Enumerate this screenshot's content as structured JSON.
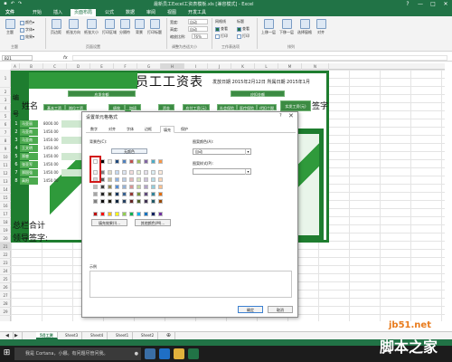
{
  "window": {
    "title": "最新员工Excel工资表模板.xls [兼容模式] - Excel",
    "controls": [
      "?",
      "—",
      "□",
      "✕"
    ]
  },
  "ribbon": {
    "tabs": [
      "文件",
      "开始",
      "插入",
      "页面布局",
      "公式",
      "数据",
      "审阅",
      "视图",
      "开发工具"
    ],
    "active_tab": "页面布局",
    "buttons": {
      "themes": "主题",
      "colors": "颜色▾",
      "fonts": "字体▾",
      "effects": "效果▾",
      "margins": "页边距",
      "orientation": "纸张方向",
      "size": "纸张大小",
      "print_area": "打印区域",
      "breaks": "分隔符",
      "background": "背景",
      "print_titles": "打印标题",
      "bring_forward": "上移一层",
      "send_backward": "下移一层",
      "selection_pane": "选择窗格",
      "align": "对齐"
    },
    "scale": {
      "width_label": "宽度:",
      "width_value": "自动",
      "height_label": "高度:",
      "height_value": "自动",
      "scale_label": "缩放比例:",
      "scale_value": "76%"
    },
    "sheet_options": {
      "gridlines": "网格线",
      "headings": "标题",
      "view": "查看",
      "print": "打印"
    },
    "groups": [
      "主题",
      "页面设置",
      "调整为合适大小",
      "工作表选项",
      "排列"
    ]
  },
  "formula_bar": {
    "name_box": "B21",
    "fx": "fx",
    "value": ""
  },
  "columns": [
    "A",
    "B",
    "C",
    "D",
    "E",
    "F",
    "G",
    "H",
    "I",
    "J",
    "K",
    "L",
    "M",
    "N"
  ],
  "rows": [
    "1",
    "2",
    "3",
    "4",
    "5",
    "6",
    "7",
    "8",
    "9",
    "10",
    "11",
    "12",
    "13",
    "14",
    "15",
    "16",
    "17",
    "18",
    "19",
    "20",
    "21",
    "22",
    "23",
    "24",
    "25",
    "26",
    "27",
    "28",
    "29"
  ],
  "payroll": {
    "title": "员工工资表",
    "date_line": "发放日期  2015年2月12日 所属日期  2015年1月",
    "bian": "编",
    "hao": "号",
    "name_header": "姓名",
    "signature": "签字",
    "header_groups": [
      "应发金额",
      "应扣金额"
    ],
    "header_cells": [
      "基本工资",
      "岗位工资",
      "绩效",
      "加班",
      "资金",
      "应付工资(元)",
      "社会保险",
      "医疗保险",
      "代扣个税",
      "实发工资(元)"
    ],
    "employees": [
      {
        "no": "1",
        "name": "马亚丽",
        "basic": "8000.00"
      },
      {
        "no": "2",
        "name": "马亚南",
        "basic": "1450.00"
      },
      {
        "no": "3",
        "name": "马亚南",
        "basic": "1450.00"
      },
      {
        "no": "4",
        "name": "王文明",
        "basic": "1450.00"
      },
      {
        "no": "5",
        "name": "郑睿",
        "basic": "1450.00"
      },
      {
        "no": "6",
        "name": "张亚军",
        "basic": "1450.00"
      },
      {
        "no": "7",
        "name": "郑国强",
        "basic": "1450.00"
      },
      {
        "no": "8",
        "name": "高阳",
        "basic": "1450.00"
      }
    ],
    "total": "总栏合计",
    "approver": "领导签字:"
  },
  "dialog": {
    "title": "设置单元格格式",
    "help": "?",
    "close": "✕",
    "tabs": [
      "数字",
      "对齐",
      "字体",
      "边框",
      "填充",
      "保护"
    ],
    "active_tab": "填充",
    "bg_color_label": "背景色(C):",
    "no_color": "无颜色",
    "fill_effects": "填充效果(I)...",
    "more_colors": "其他颜色(M)...",
    "pattern_color_label": "图案颜色(A):",
    "pattern_color_value": "自动",
    "pattern_style_label": "图案样式(P):",
    "pattern_style_value": "",
    "sample_label": "示例",
    "ok": "确定",
    "cancel": "取消",
    "swatch_colors": [
      [
        "#ffffff",
        "#000000",
        "#eeece1",
        "#1f497d",
        "#4f81bd",
        "#c0504d",
        "#9bbb59",
        "#8064a2",
        "#4bacc6",
        "#f79646"
      ],
      [
        "#f2f2f2",
        "#7f7f7f",
        "#ddd9c3",
        "#c6d9f0",
        "#dbe5f1",
        "#f2dcdb",
        "#ebf1dd",
        "#e5e0ec",
        "#dbeef3",
        "#fdeada"
      ],
      [
        "#d8d8d8",
        "#595959",
        "#c4bd97",
        "#8db3e2",
        "#b8cce4",
        "#e5b9b7",
        "#d7e3bc",
        "#ccc1d9",
        "#b7dde8",
        "#fbd5b5"
      ],
      [
        "#bfbfbf",
        "#3f3f3f",
        "#938953",
        "#548dd4",
        "#95b3d7",
        "#d99694",
        "#c3d69b",
        "#b2a2c7",
        "#92cddc",
        "#fac08f"
      ],
      [
        "#a5a5a5",
        "#262626",
        "#494429",
        "#17365d",
        "#366092",
        "#953734",
        "#76923c",
        "#5f497a",
        "#31859b",
        "#e36c09"
      ],
      [
        "#7f7f7f",
        "#0c0c0c",
        "#1d1b10",
        "#0f243e",
        "#244061",
        "#632423",
        "#4f6128",
        "#3f3151",
        "#205867",
        "#974806"
      ],
      [
        "#c00000",
        "#ff0000",
        "#ffc000",
        "#ffff00",
        "#92d050",
        "#00b050",
        "#00b0f0",
        "#0070c0",
        "#002060",
        "#7030a0"
      ]
    ]
  },
  "sheet_tabs": [
    "5月工资",
    "Sheet3",
    "Sheet4",
    "Sheet1",
    "Sheet2"
  ],
  "active_sheet": "5月工资",
  "taskbar": {
    "search_text": "我是 Cortana，小娜。有问题尽管问我。"
  },
  "watermark": {
    "site": "jb51.net",
    "brand": "脚本之家"
  },
  "colors": {
    "excel_green": "#217346",
    "frame_green": "#1e7d2f",
    "highlight_red": "#d21a1a"
  }
}
